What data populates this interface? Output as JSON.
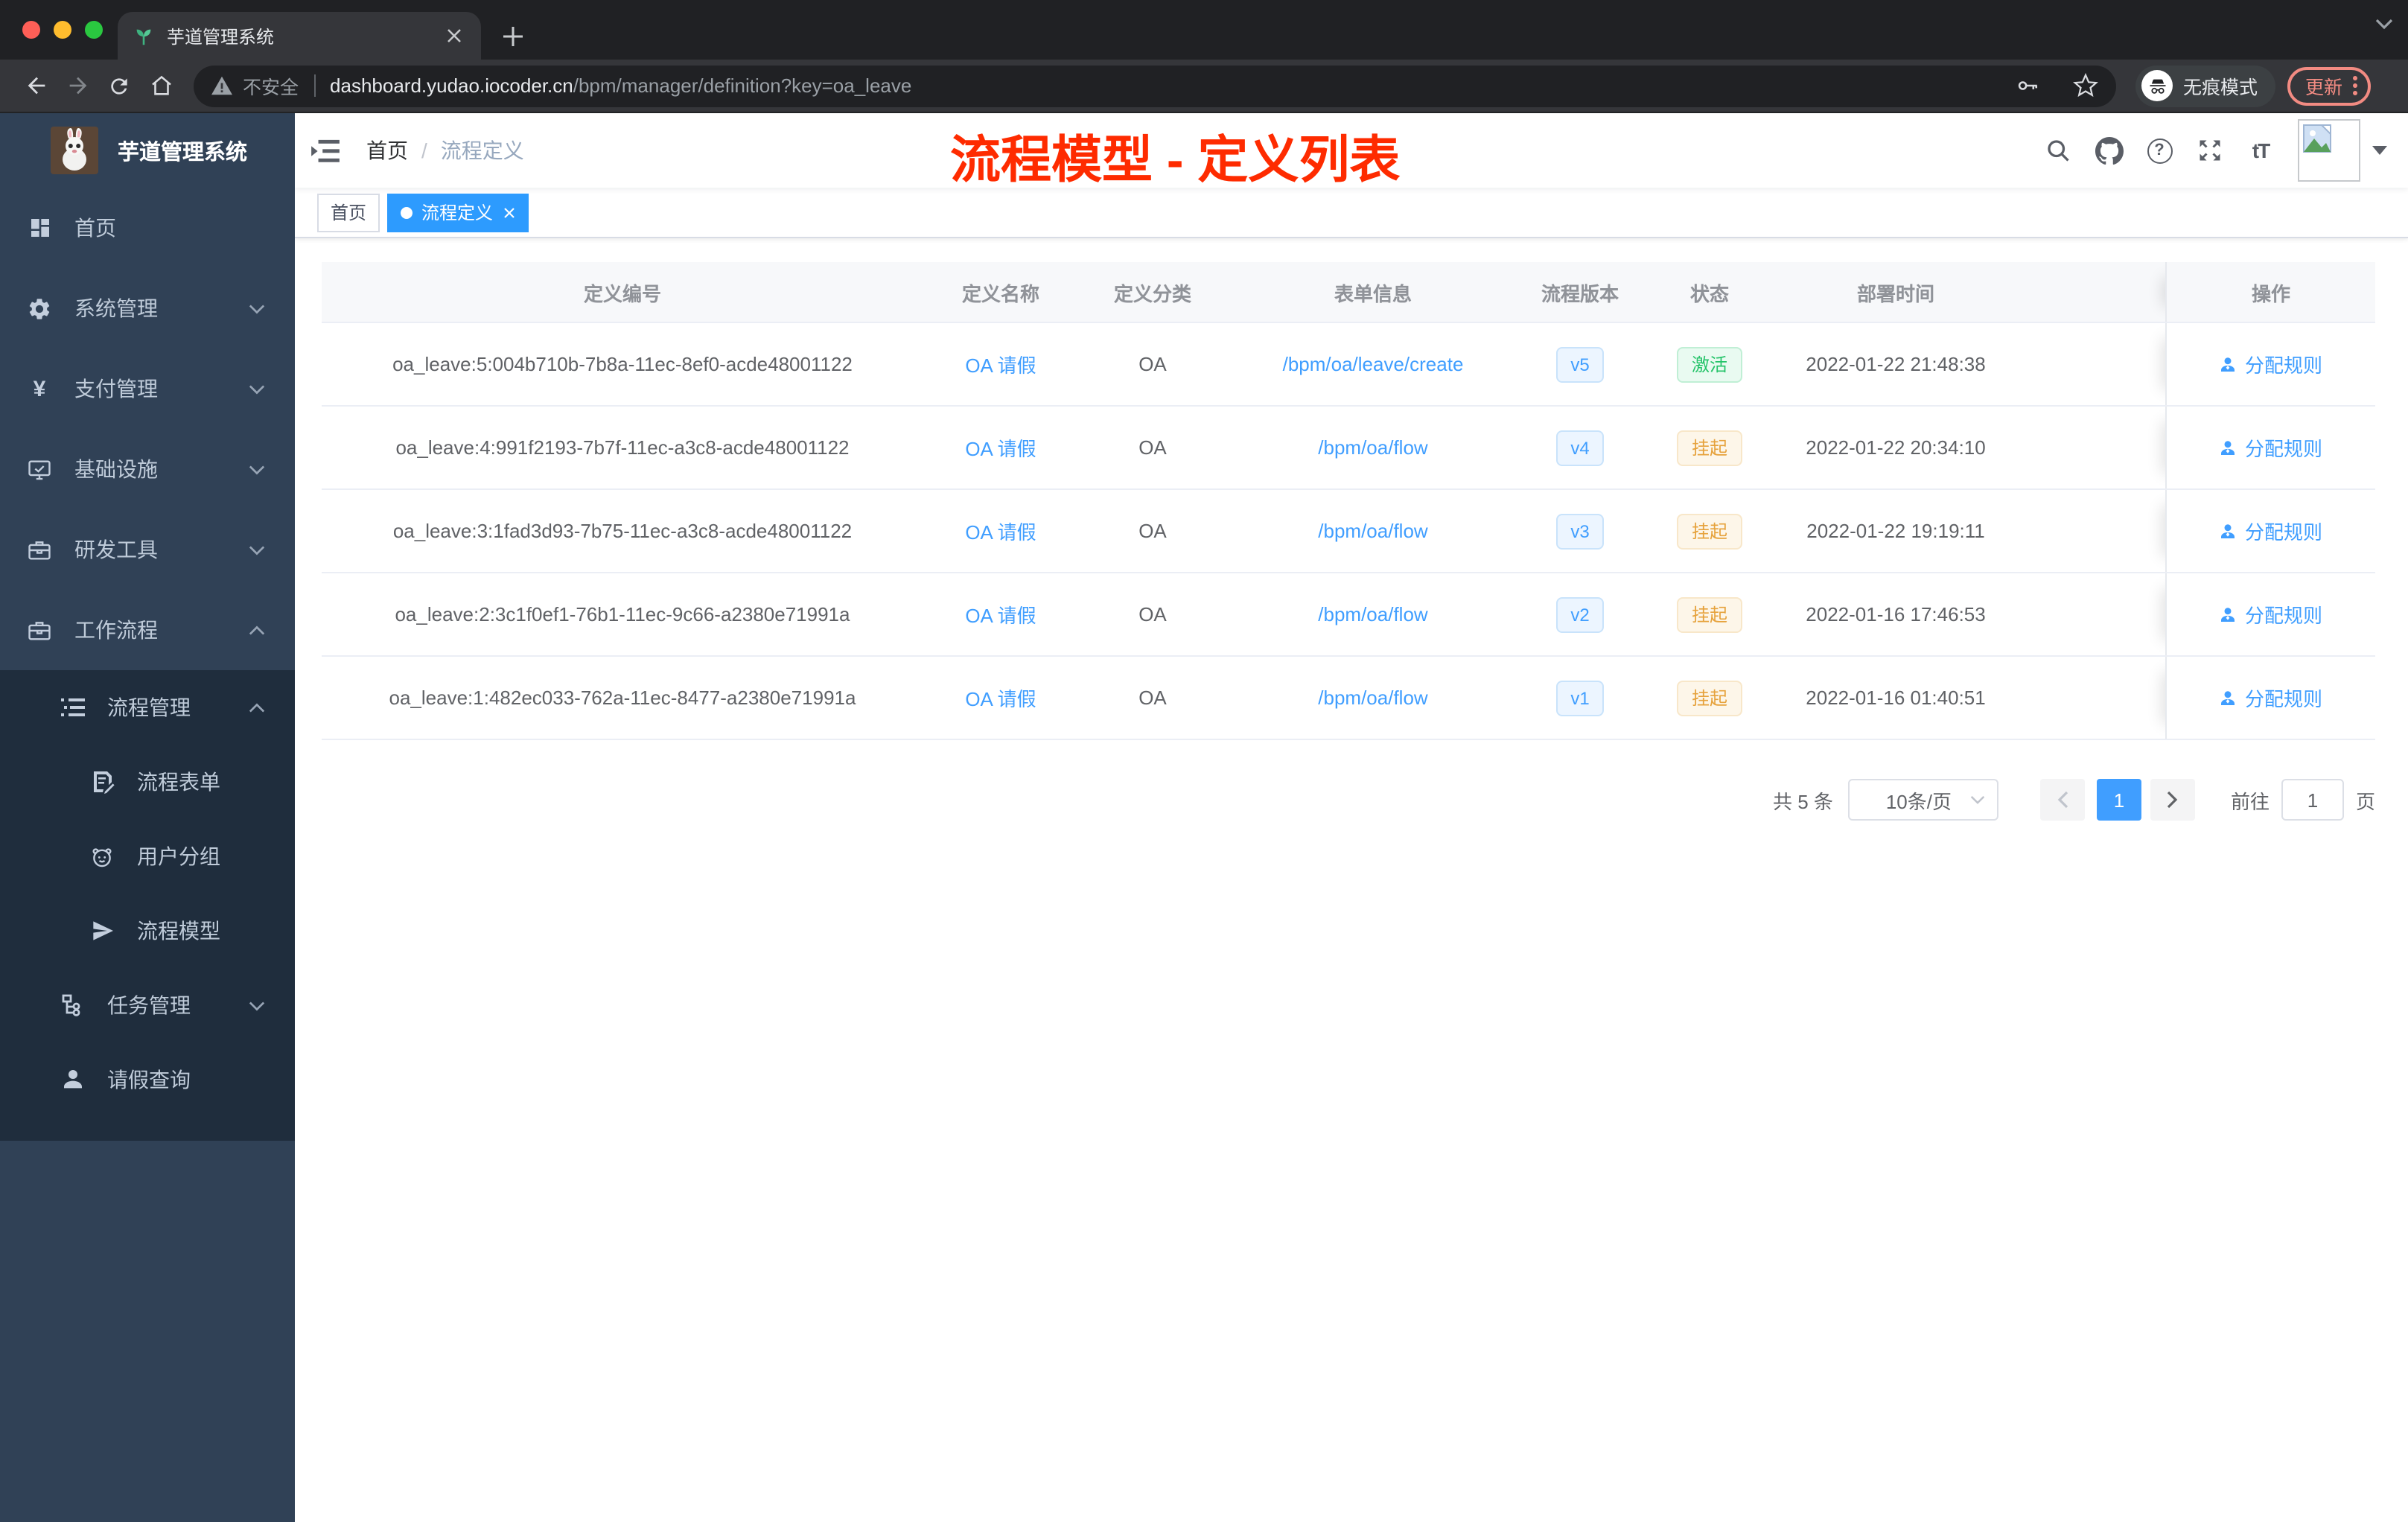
{
  "browser": {
    "tab": {
      "title": "芋道管理系统"
    },
    "toolbar": {
      "security_label": "不安全",
      "url_domain": "dashboard.yudao.iocoder.cn",
      "url_path": "/bpm/manager/definition?key=oa_leave",
      "incognito_label": "无痕模式",
      "update_label": "更新"
    }
  },
  "sidebar": {
    "logo_title": "芋道管理系统",
    "menu": [
      {
        "label": "首页",
        "icon": "dashboard-icon"
      },
      {
        "label": "系统管理",
        "icon": "gear-icon",
        "arrow": "down"
      },
      {
        "label": "支付管理",
        "icon": "yen-icon",
        "glyph": "¥",
        "arrow": "down"
      },
      {
        "label": "基础设施",
        "icon": "monitor-icon",
        "arrow": "down"
      },
      {
        "label": "研发工具",
        "icon": "toolbox-icon",
        "arrow": "down"
      },
      {
        "label": "工作流程",
        "icon": "briefcase-icon",
        "arrow": "up"
      }
    ],
    "submenu": [
      {
        "label": "流程管理",
        "icon": "list-icon",
        "arrow": "up",
        "level": 1
      },
      {
        "label": "流程表单",
        "icon": "form-icon",
        "level": 2
      },
      {
        "label": "用户分组",
        "icon": "people-icon",
        "level": 2
      },
      {
        "label": "流程模型",
        "icon": "send-icon",
        "level": 2
      },
      {
        "label": "任务管理",
        "icon": "tree-icon",
        "arrow": "down",
        "level": 1
      },
      {
        "label": "请假查询",
        "icon": "user-icon",
        "level": 1
      }
    ]
  },
  "navbar": {
    "breadcrumb": [
      "首页",
      "流程定义"
    ],
    "breadcrumb_sep": "/"
  },
  "annotation": {
    "text": "流程模型 - 定义列表",
    "color": "#fe2b00"
  },
  "tags": [
    {
      "label": "首页",
      "active": false
    },
    {
      "label": "流程定义",
      "active": true,
      "closable": true
    }
  ],
  "icons": {
    "help_glyph": "?",
    "font_size_glyph": "tT"
  },
  "colors": {
    "accent_blue": "#409eff",
    "tag_active": "#2d9bfe",
    "success_text": "#23c368",
    "warning_text": "#e6a23c",
    "sidebar_bg": "#304156",
    "submenu_bg": "#1f2d3d",
    "annotation_red": "#fe2b00",
    "update_salmon": "#f28b82"
  },
  "table": {
    "columns": [
      "定义编号",
      "定义名称",
      "定义分类",
      "表单信息",
      "流程版本",
      "状态",
      "部署时间",
      "操作"
    ],
    "rows": [
      {
        "id": "oa_leave:5:004b710b-7b8a-11ec-8ef0-acde48001122",
        "name": "OA 请假",
        "category": "OA",
        "form": "/bpm/oa/leave/create",
        "version": "v5",
        "status": "激活",
        "status_type": "success",
        "deploy_time": "2022-01-22 21:48:38",
        "action": "分配规则"
      },
      {
        "id": "oa_leave:4:991f2193-7b7f-11ec-a3c8-acde48001122",
        "name": "OA 请假",
        "category": "OA",
        "form": "/bpm/oa/flow",
        "version": "v4",
        "status": "挂起",
        "status_type": "warning",
        "deploy_time": "2022-01-22 20:34:10",
        "action": "分配规则"
      },
      {
        "id": "oa_leave:3:1fad3d93-7b75-11ec-a3c8-acde48001122",
        "name": "OA 请假",
        "category": "OA",
        "form": "/bpm/oa/flow",
        "version": "v3",
        "status": "挂起",
        "status_type": "warning",
        "deploy_time": "2022-01-22 19:19:11",
        "action": "分配规则"
      },
      {
        "id": "oa_leave:2:3c1f0ef1-76b1-11ec-9c66-a2380e71991a",
        "name": "OA 请假",
        "category": "OA",
        "form": "/bpm/oa/flow",
        "version": "v2",
        "status": "挂起",
        "status_type": "warning",
        "deploy_time": "2022-01-16 17:46:53",
        "action": "分配规则"
      },
      {
        "id": "oa_leave:1:482ec033-762a-11ec-8477-a2380e71991a",
        "name": "OA 请假",
        "category": "OA",
        "form": "/bpm/oa/flow",
        "version": "v1",
        "status": "挂起",
        "status_type": "warning",
        "deploy_time": "2022-01-16 01:40:51",
        "action": "分配规则"
      }
    ]
  },
  "pagination": {
    "total_label": "共 5 条",
    "page_size": "10条/页",
    "current_page": "1",
    "goto_label": "前往",
    "goto_value": "1",
    "page_suffix": "页"
  }
}
